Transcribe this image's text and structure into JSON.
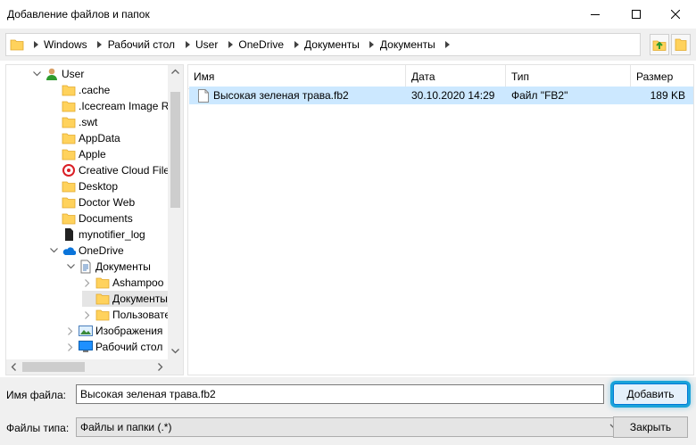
{
  "window": {
    "title": "Добавление файлов и папок"
  },
  "breadcrumb": [
    "Windows",
    "Рабочий стол",
    "User",
    "OneDrive",
    "Документы",
    "Документы"
  ],
  "tree": {
    "items": [
      {
        "label": "User",
        "icon": "user-icon",
        "indent": 1,
        "twisty": "open"
      },
      {
        "label": ".cache",
        "icon": "folder-icon",
        "indent": 2,
        "twisty": "none"
      },
      {
        "label": ".Icecream Image Re",
        "icon": "folder-icon",
        "indent": 2,
        "twisty": "none"
      },
      {
        "label": ".swt",
        "icon": "folder-icon",
        "indent": 2,
        "twisty": "none"
      },
      {
        "label": "AppData",
        "icon": "folder-icon",
        "indent": 2,
        "twisty": "none"
      },
      {
        "label": "Apple",
        "icon": "folder-icon",
        "indent": 2,
        "twisty": "none"
      },
      {
        "label": "Creative Cloud File",
        "icon": "creative-cloud-icon",
        "indent": 2,
        "twisty": "none"
      },
      {
        "label": "Desktop",
        "icon": "folder-icon",
        "indent": 2,
        "twisty": "none"
      },
      {
        "label": "Doctor Web",
        "icon": "folder-icon",
        "indent": 2,
        "twisty": "none"
      },
      {
        "label": "Documents",
        "icon": "folder-icon",
        "indent": 2,
        "twisty": "none"
      },
      {
        "label": "mynotifier_log",
        "icon": "file-dark-icon",
        "indent": 2,
        "twisty": "none"
      },
      {
        "label": "OneDrive",
        "icon": "onedrive-cloud-icon",
        "indent": 2,
        "twisty": "open"
      },
      {
        "label": "Документы",
        "icon": "documents-icon",
        "indent": 3,
        "twisty": "open"
      },
      {
        "label": "Ashampoo",
        "icon": "folder-icon",
        "indent": 4,
        "twisty": "closed"
      },
      {
        "label": "Документы",
        "icon": "folder-icon",
        "indent": 4,
        "twisty": "none",
        "selected": true
      },
      {
        "label": "Пользовате",
        "icon": "folder-icon",
        "indent": 4,
        "twisty": "closed"
      },
      {
        "label": "Изображения",
        "icon": "pictures-icon",
        "indent": 3,
        "twisty": "closed"
      },
      {
        "label": "Рабочий стол",
        "icon": "desktop-icon",
        "indent": 3,
        "twisty": "closed"
      }
    ]
  },
  "list": {
    "columns": {
      "name": "Имя",
      "date": "Дата",
      "type": "Тип",
      "size": "Размер"
    },
    "rows": [
      {
        "name": "Высокая зеленая трава.fb2",
        "date": "30.10.2020 14:29",
        "type": "Файл \"FB2\"",
        "size": "189 KB"
      }
    ]
  },
  "filename": {
    "label": "Имя файла:",
    "value": "Высокая зеленая трава.fb2"
  },
  "filetype": {
    "label": "Файлы типа:",
    "value": "Файлы и папки (.*)"
  },
  "buttons": {
    "add": "Добавить",
    "close": "Закрыть"
  },
  "colors": {
    "selection": "#cce8ff",
    "accent": "#1aa3d9",
    "folder": "#ffd25c"
  }
}
